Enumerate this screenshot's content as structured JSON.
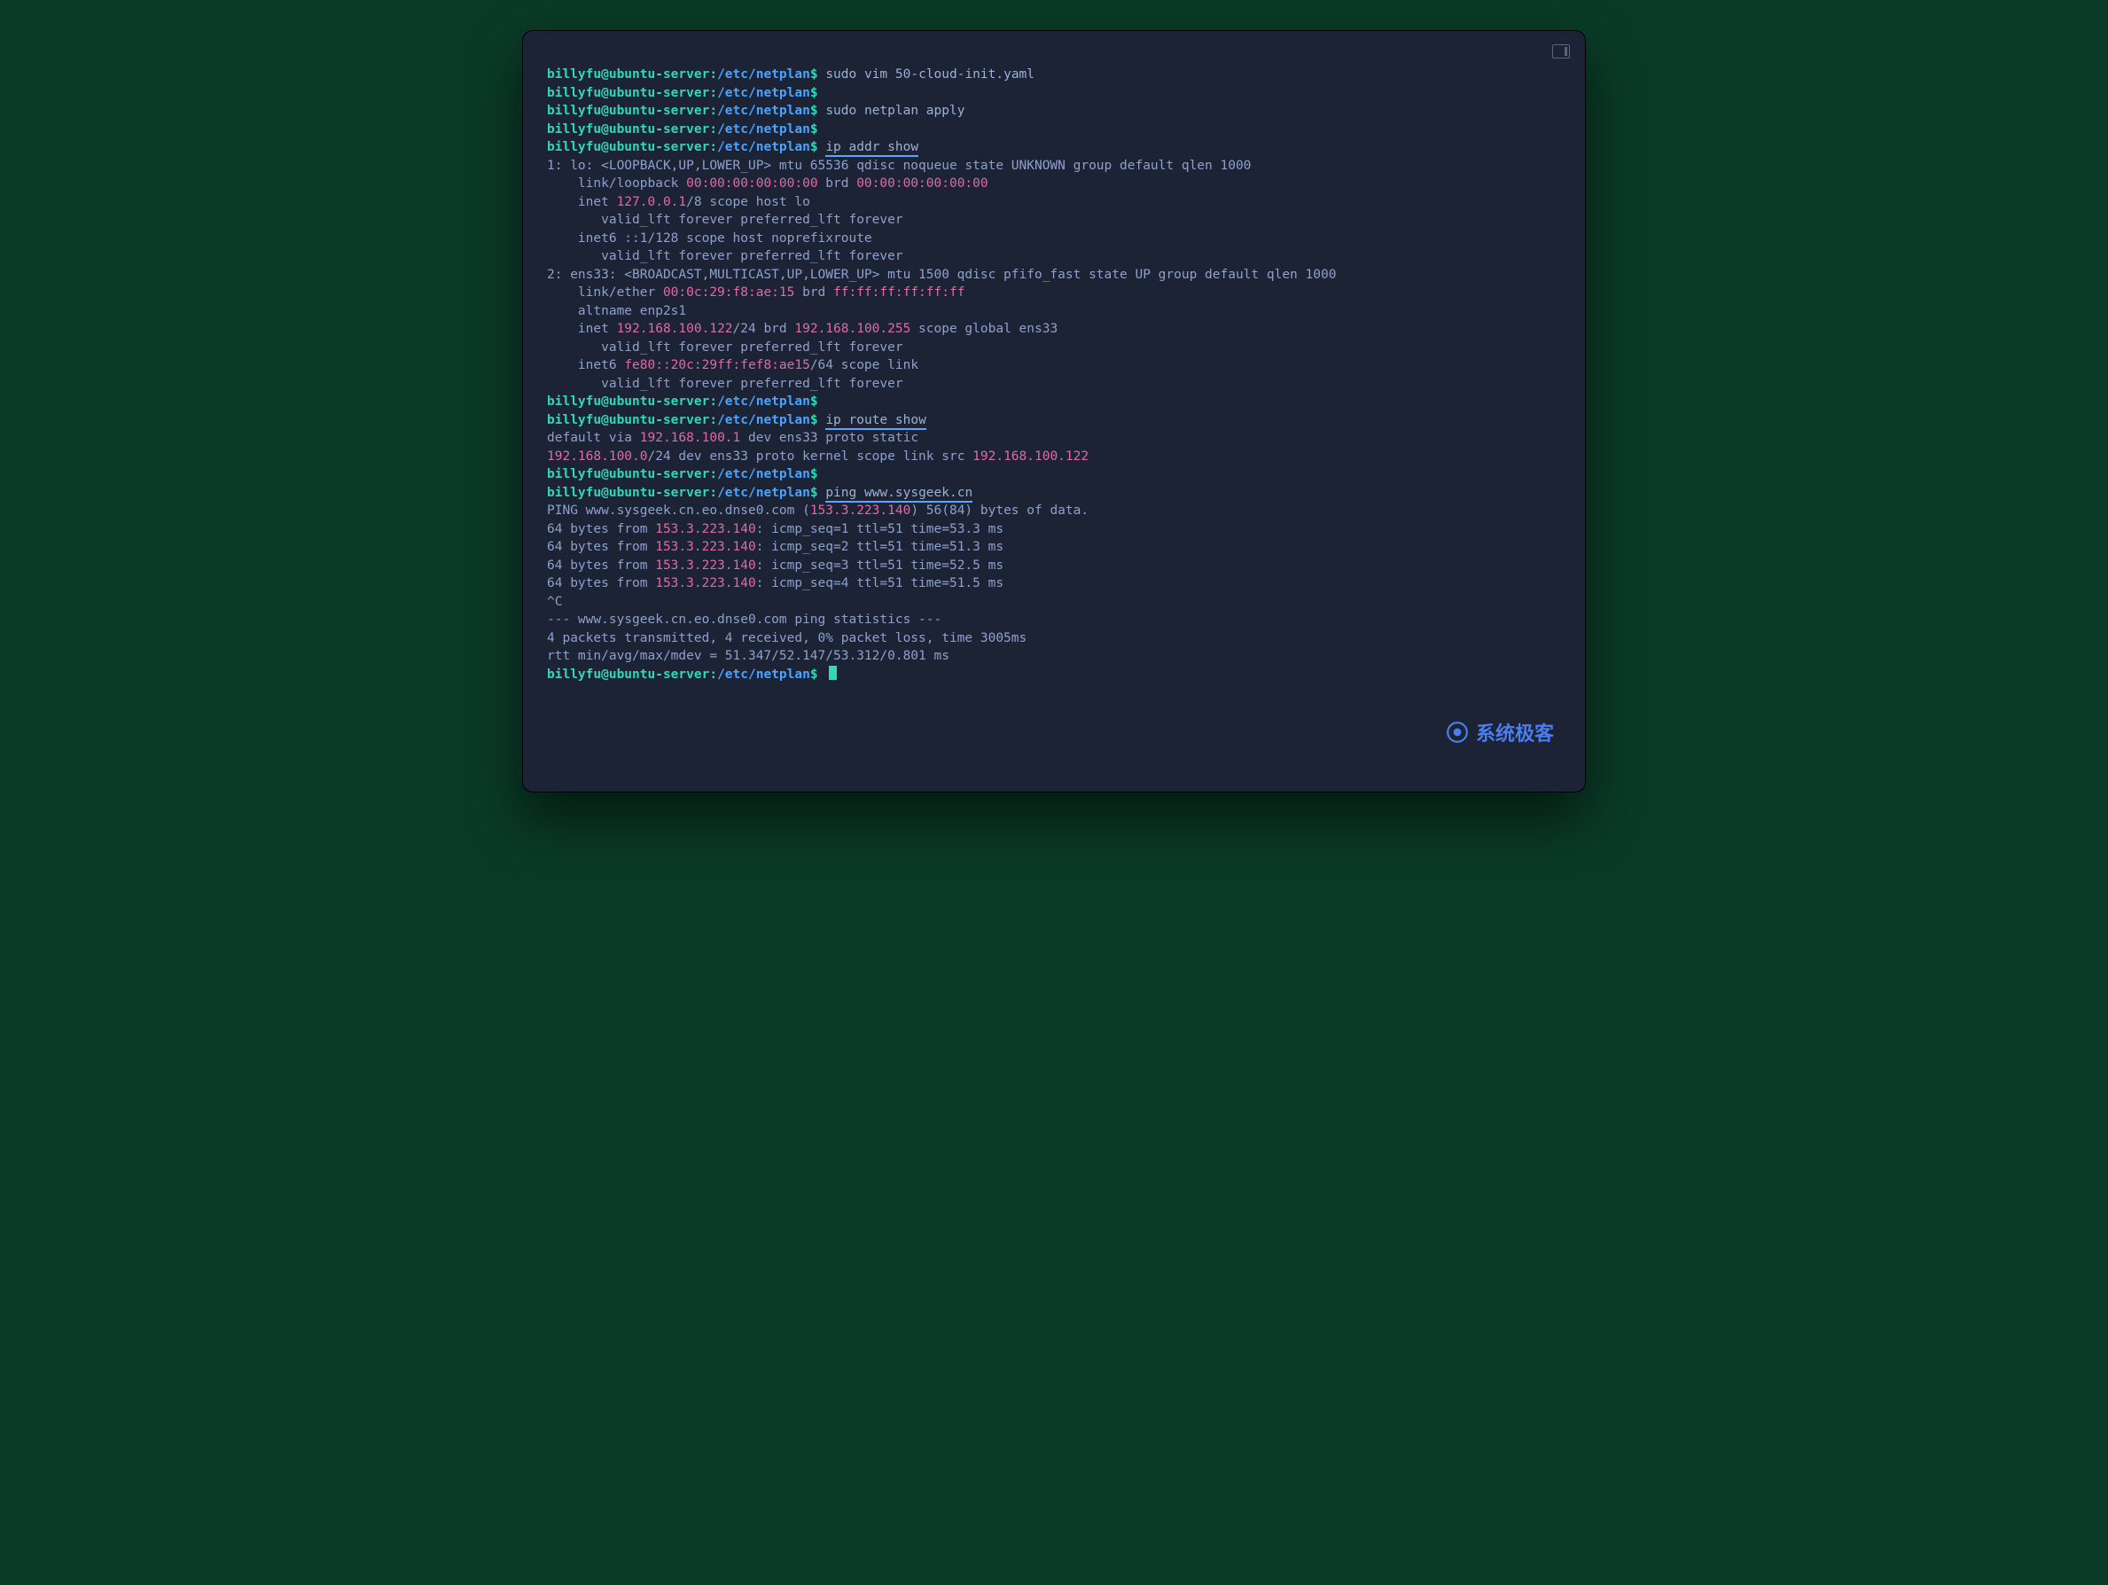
{
  "prompt": {
    "user": "billyfu",
    "at": "@",
    "host": "ubuntu-server",
    "colon": ":",
    "path": "/etc/netplan",
    "dollar": "$"
  },
  "watermark": "系统极客",
  "lines": [
    {
      "t": "p",
      "cmd": "sudo vim 50-cloud-init.yaml"
    },
    {
      "t": "p",
      "cmd": ""
    },
    {
      "t": "p",
      "cmd": "sudo netplan apply"
    },
    {
      "t": "p",
      "cmd": ""
    },
    {
      "t": "p",
      "cmd": "ip addr show",
      "ul": true
    },
    {
      "t": "o",
      "spans": [
        {
          "x": "1: lo: <LOOPBACK,UP,LOWER_UP> mtu 65536 qdisc noqueue state UNKNOWN group default qlen 1000"
        }
      ]
    },
    {
      "t": "o",
      "spans": [
        {
          "x": "    link/loopback "
        },
        {
          "x": "00:00:00:00:00:00",
          "c": "pink"
        },
        {
          "x": " brd "
        },
        {
          "x": "00:00:00:00:00:00",
          "c": "pink"
        }
      ]
    },
    {
      "t": "o",
      "spans": [
        {
          "x": "    inet "
        },
        {
          "x": "127.0.0.1",
          "c": "pink"
        },
        {
          "x": "/8 scope host lo"
        }
      ]
    },
    {
      "t": "o",
      "spans": [
        {
          "x": "       valid_lft forever preferred_lft forever"
        }
      ]
    },
    {
      "t": "o",
      "spans": [
        {
          "x": "    inet6 ::1/128 scope host noprefixroute"
        }
      ]
    },
    {
      "t": "o",
      "spans": [
        {
          "x": "       valid_lft forever preferred_lft forever"
        }
      ]
    },
    {
      "t": "o",
      "spans": [
        {
          "x": "2: ens33: <BROADCAST,MULTICAST,UP,LOWER_UP> mtu 1500 qdisc pfifo_fast state UP group default qlen 1000"
        }
      ]
    },
    {
      "t": "o",
      "spans": [
        {
          "x": "    link/ether "
        },
        {
          "x": "00:0c:29:f8:ae:15",
          "c": "pink"
        },
        {
          "x": " brd "
        },
        {
          "x": "ff:ff:ff:ff:ff:ff",
          "c": "pink"
        }
      ]
    },
    {
      "t": "o",
      "spans": [
        {
          "x": "    altname enp2s1"
        }
      ]
    },
    {
      "t": "o",
      "spans": [
        {
          "x": "    inet "
        },
        {
          "x": "192.168.100.122",
          "c": "pink"
        },
        {
          "x": "/24 brd "
        },
        {
          "x": "192.168.100.255",
          "c": "pink"
        },
        {
          "x": " scope global ens33"
        }
      ]
    },
    {
      "t": "o",
      "spans": [
        {
          "x": "       valid_lft forever preferred_lft forever"
        }
      ]
    },
    {
      "t": "o",
      "spans": [
        {
          "x": "    inet6 "
        },
        {
          "x": "fe80::20c:29ff:fef8:ae15",
          "c": "pink"
        },
        {
          "x": "/64 scope link"
        }
      ]
    },
    {
      "t": "o",
      "spans": [
        {
          "x": "       valid_lft forever preferred_lft forever"
        }
      ]
    },
    {
      "t": "p",
      "cmd": ""
    },
    {
      "t": "p",
      "cmd": "ip route show",
      "ul": true
    },
    {
      "t": "o",
      "spans": [
        {
          "x": "default via "
        },
        {
          "x": "192.168.100.1",
          "c": "pink"
        },
        {
          "x": " dev ens33 proto static"
        }
      ]
    },
    {
      "t": "o",
      "spans": [
        {
          "x": "192.168.100.0",
          "c": "pink"
        },
        {
          "x": "/24 dev ens33 proto kernel scope link src "
        },
        {
          "x": "192.168.100.122",
          "c": "pink"
        }
      ]
    },
    {
      "t": "p",
      "cmd": ""
    },
    {
      "t": "p",
      "cmd": "ping www.sysgeek.cn",
      "ul": true
    },
    {
      "t": "o",
      "spans": [
        {
          "x": "PING www.sysgeek.cn.eo.dnse0.com ("
        },
        {
          "x": "153.3.223.140",
          "c": "pink"
        },
        {
          "x": ") 56(84) bytes of data."
        }
      ]
    },
    {
      "t": "o",
      "spans": [
        {
          "x": "64 bytes from "
        },
        {
          "x": "153.3.223.140",
          "c": "pink"
        },
        {
          "x": ": icmp_seq=1 ttl=51 time=53.3 ms"
        }
      ]
    },
    {
      "t": "o",
      "spans": [
        {
          "x": "64 bytes from "
        },
        {
          "x": "153.3.223.140",
          "c": "pink"
        },
        {
          "x": ": icmp_seq=2 ttl=51 time=51.3 ms"
        }
      ]
    },
    {
      "t": "o",
      "spans": [
        {
          "x": "64 bytes from "
        },
        {
          "x": "153.3.223.140",
          "c": "pink"
        },
        {
          "x": ": icmp_seq=3 ttl=51 time=52.5 ms"
        }
      ]
    },
    {
      "t": "o",
      "spans": [
        {
          "x": "64 bytes from "
        },
        {
          "x": "153.3.223.140",
          "c": "pink"
        },
        {
          "x": ": icmp_seq=4 ttl=51 time=51.5 ms"
        }
      ]
    },
    {
      "t": "o",
      "spans": [
        {
          "x": "^C"
        }
      ]
    },
    {
      "t": "o",
      "spans": [
        {
          "x": "--- www.sysgeek.cn.eo.dnse0.com ping statistics ---"
        }
      ]
    },
    {
      "t": "o",
      "spans": [
        {
          "x": "4 packets transmitted, 4 received, 0% packet loss, time 3005ms"
        }
      ]
    },
    {
      "t": "o",
      "spans": [
        {
          "x": "rtt min/avg/max/mdev = 51.347/52.147/53.312/0.801 ms"
        }
      ]
    },
    {
      "t": "p",
      "cmd": "",
      "cursor": true
    }
  ]
}
